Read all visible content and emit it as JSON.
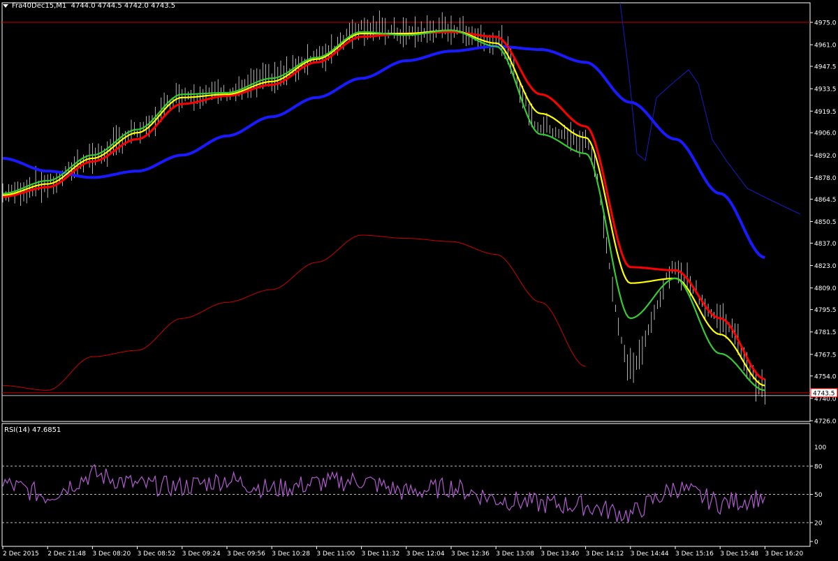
{
  "header": {
    "symbol": "Fra40Dec15,M1",
    "ohlc": "4744.0 4744.5 4742.0 4743.5"
  },
  "colors": {
    "background": "#000000",
    "frame": "#ffffff",
    "price_bars": "#ffffff",
    "ma_slow": "#1a1aff",
    "ma_red": "#ff0000",
    "ma_yellow": "#ffff00",
    "ma_green": "#33cc33",
    "band_upper_red": "#cc0000",
    "band_lower_red": "#cc0000",
    "blue_thin": "#1a1acc",
    "rsi_line": "#b05ccf",
    "level_line": "#cc0000",
    "bid_line": "#c0c0c0"
  },
  "price_axis": {
    "labels": [
      "4975.0",
      "4961.0",
      "4947.5",
      "4933.5",
      "4919.5",
      "4906.0",
      "4892.0",
      "4878.0",
      "4864.5",
      "4850.5",
      "4837.0",
      "4823.0",
      "4809.0",
      "4795.5",
      "4781.5",
      "4767.5",
      "4754.0",
      "4740.0",
      "4726.0"
    ],
    "current_price": "4743.5"
  },
  "rsi": {
    "label": "RSI(14) 47.6851",
    "levels": [
      "80",
      "50",
      "20",
      "0"
    ],
    "top_label": "100"
  },
  "time_axis": {
    "labels": [
      "2 Dec 2015",
      "2 Dec 21:48",
      "3 Dec 08:20",
      "3 Dec 08:52",
      "3 Dec 09:24",
      "3 Dec 09:56",
      "3 Dec 10:28",
      "3 Dec 11:00",
      "3 Dec 11:32",
      "3 Dec 12:04",
      "3 Dec 12:36",
      "3 Dec 13:08",
      "3 Dec 13:40",
      "3 Dec 14:12",
      "3 Dec 14:44",
      "3 Dec 15:16",
      "3 Dec 15:48",
      "3 Dec 16:20"
    ]
  },
  "chart_data": {
    "type": "line",
    "title": "Fra40Dec15,M1",
    "x": [
      "2 Dec 2015",
      "2 Dec 21:48",
      "3 Dec 08:20",
      "3 Dec 08:52",
      "3 Dec 09:24",
      "3 Dec 09:56",
      "3 Dec 10:28",
      "3 Dec 11:00",
      "3 Dec 11:32",
      "3 Dec 12:04",
      "3 Dec 12:36",
      "3 Dec 13:08",
      "3 Dec 13:40",
      "3 Dec 14:12",
      "3 Dec 14:44",
      "3 Dec 15:16",
      "3 Dec 15:48",
      "3 Dec 16:20"
    ],
    "ylim": [
      4726.0,
      4975.0
    ],
    "horizontal_levels": [
      4975.0,
      4743.5
    ],
    "price_close": [
      4868,
      4874,
      4891,
      4906,
      4930,
      4931,
      4940,
      4953,
      4972,
      4968,
      4971,
      4964,
      4910,
      4900,
      4760,
      4820,
      4790,
      4746
    ],
    "series": [
      {
        "values": [
          4890,
          4882,
          4878,
          4882,
          4892,
          4904,
          4916,
          4928,
          4940,
          4951,
          4957,
          4960,
          4958,
          4950,
          4925,
          4902,
          4868,
          4828
        ]
      },
      {
        "values": [
          4866,
          4872,
          4888,
          4902,
          4924,
          4929,
          4936,
          4950,
          4966,
          4968,
          4969,
          4966,
          4930,
          4910,
          4822,
          4820,
          4790,
          4752
        ]
      },
      {
        "values": [
          4867,
          4874,
          4890,
          4906,
          4928,
          4930,
          4938,
          4952,
          4968,
          4968,
          4970,
          4962,
          4918,
          4903,
          4812,
          4815,
          4780,
          4748
        ]
      },
      {
        "values": [
          4868,
          4876,
          4892,
          4908,
          4930,
          4931,
          4940,
          4953,
          4969,
          4967,
          4970,
          4960,
          4905,
          4893,
          4790,
          4815,
          4768,
          4745
        ]
      }
    ],
    "rsi_values": [
      62,
      48,
      72,
      60,
      58,
      66,
      55,
      62,
      65,
      52,
      58,
      45,
      40,
      38,
      28,
      58,
      40,
      47.7
    ],
    "rsi_ylim": [
      0,
      100
    ]
  }
}
